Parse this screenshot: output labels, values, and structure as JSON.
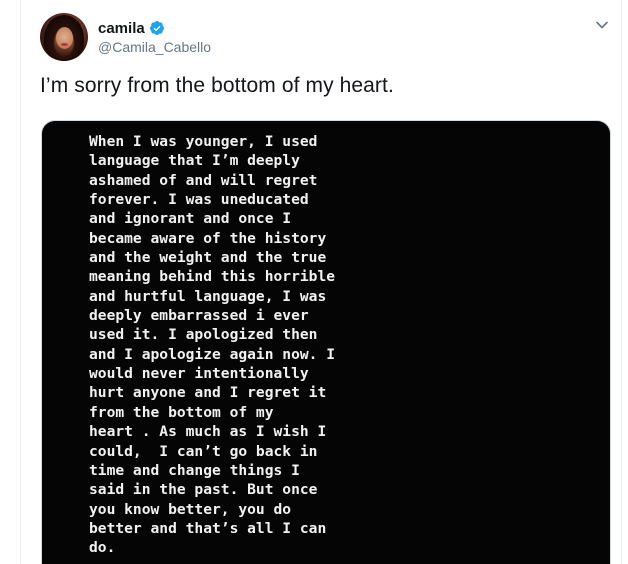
{
  "user": {
    "display_name": "camila",
    "handle": "@Camila_Cabello",
    "verified": true,
    "avatar_icon": "profile-photo"
  },
  "tweet": {
    "text": "I’m sorry from the bottom of my heart."
  },
  "media": {
    "text": "When I was younger, I used\nlanguage that I’m deeply\nashamed of and will regret\nforever. I was uneducated\nand ignorant and once I\nbecame aware of the history\nand the weight and the true\nmeaning behind this horrible\nand hurtful language, I was\ndeeply embarrassed i ever\nused it. I apologized then\nand I apologize again now. I\nwould never intentionally\nhurt anyone and I regret it\nfrom the bottom of my\nheart . As much as I wish I\ncould,  I can’t go back in\ntime and change things I\nsaid in the past. But once\nyou know better, you do\nbetter and that’s all I can\ndo."
  },
  "colors": {
    "name": "#14171a",
    "handle": "#657786",
    "verified_badge": "#1da1f2",
    "media_background": "#050505",
    "media_text": "#f2f2f2",
    "caret": "#657786"
  },
  "icons": {
    "verified": "verified-badge-icon",
    "menu": "chevron-down-icon"
  }
}
